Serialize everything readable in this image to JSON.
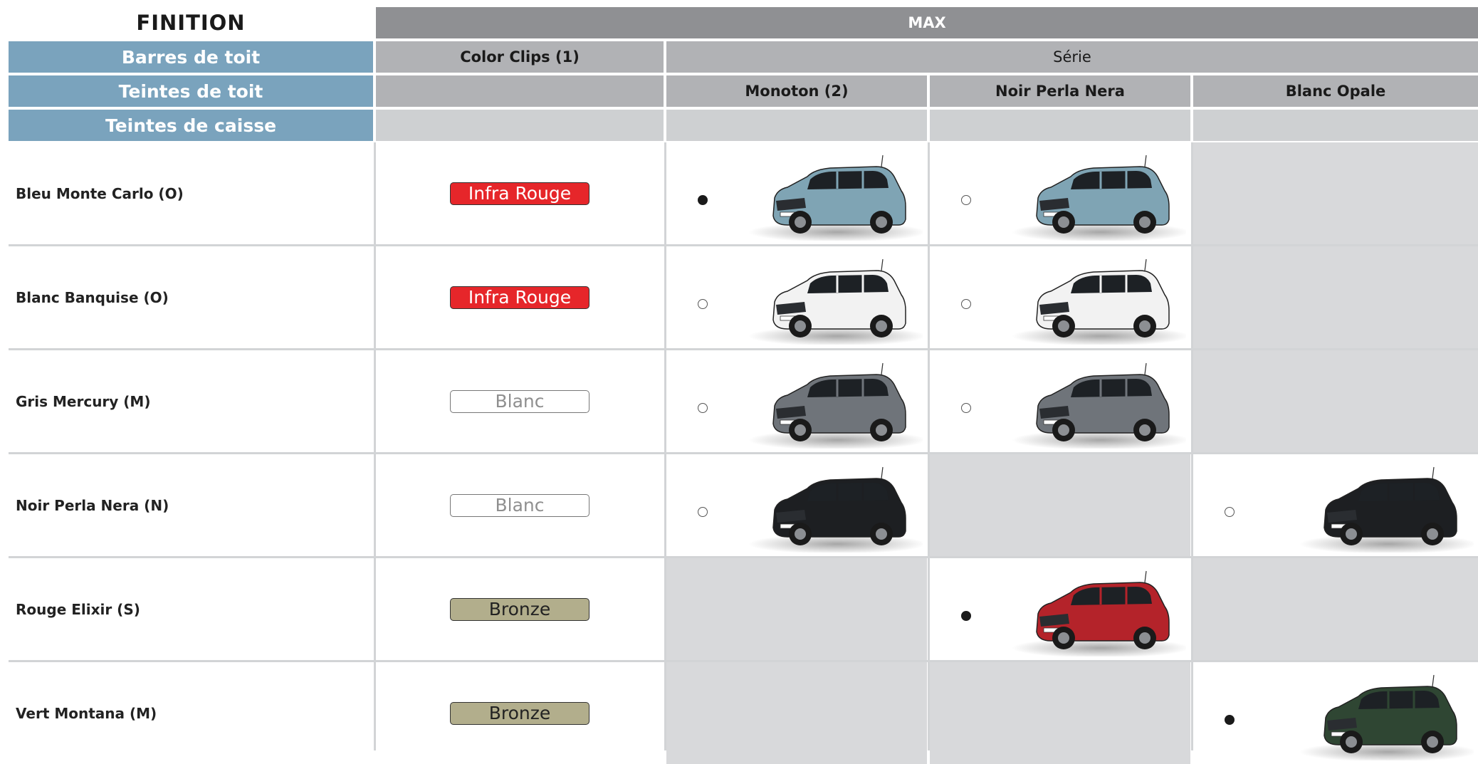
{
  "header": {
    "finition_label": "FINITION",
    "finition_value": "MAX",
    "barres_label": "Barres de toit",
    "color_clips_label": "Color Clips (1)",
    "serie_label": "Série",
    "teintes_toit_label": "Teintes de toit",
    "teintes_caisse_label": "Teintes de caisse",
    "roof_colors": [
      "Monoton (2)",
      "Noir Perla Nera",
      "Blanc Opale"
    ]
  },
  "colors": {
    "header_blue": "#7aa3bd",
    "header_grey": "#8f9093",
    "infra_rouge": "#e6262a",
    "bronze": "#b2ae8c",
    "unavailable": "#d8d9db"
  },
  "rows": [
    {
      "body_color": "Bleu Monte Carlo (O)",
      "clip": "Infra Rouge",
      "cells": [
        {
          "available": true,
          "standard": true,
          "car_color": "#7fa4b4"
        },
        {
          "available": true,
          "standard": false,
          "car_color": "#7fa4b4"
        },
        {
          "available": false
        }
      ]
    },
    {
      "body_color": "Blanc Banquise (O)",
      "clip": "Infra Rouge",
      "cells": [
        {
          "available": true,
          "standard": false,
          "car_color": "#f2f2f2"
        },
        {
          "available": true,
          "standard": false,
          "car_color": "#f2f2f2"
        },
        {
          "available": false
        }
      ]
    },
    {
      "body_color": "Gris Mercury (M)",
      "clip": "Blanc",
      "cells": [
        {
          "available": true,
          "standard": false,
          "car_color": "#6f747a"
        },
        {
          "available": true,
          "standard": false,
          "car_color": "#6f747a"
        },
        {
          "available": false
        }
      ]
    },
    {
      "body_color": "Noir Perla Nera (N)",
      "clip": "Blanc",
      "cells": [
        {
          "available": true,
          "standard": false,
          "car_color": "#1d1f22"
        },
        {
          "available": false
        },
        {
          "available": true,
          "standard": false,
          "car_color": "#1d1f22"
        }
      ]
    },
    {
      "body_color": "Rouge Elixir (S)",
      "clip": "Bronze",
      "cells": [
        {
          "available": false
        },
        {
          "available": true,
          "standard": true,
          "car_color": "#b4232a"
        },
        {
          "available": false
        }
      ]
    },
    {
      "body_color": "Vert Montana (M)",
      "clip": "Bronze",
      "cells": [
        {
          "available": false
        },
        {
          "available": false
        },
        {
          "available": true,
          "standard": true,
          "car_color": "#2f4633"
        }
      ]
    }
  ]
}
